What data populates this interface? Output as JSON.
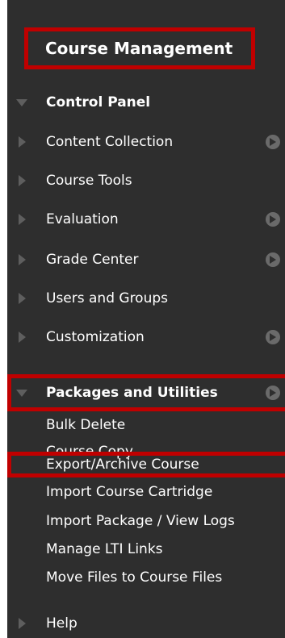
{
  "course_management": {
    "title": "Course Management",
    "accent": "#c00000"
  },
  "control_panel": {
    "label": "Control Panel",
    "expanded": true,
    "items": [
      {
        "label": "Content Collection",
        "has_arrow": true
      },
      {
        "label": "Course Tools",
        "has_arrow": false
      },
      {
        "label": "Evaluation",
        "has_arrow": true
      },
      {
        "label": "Grade Center",
        "has_arrow": true
      },
      {
        "label": "Users and Groups",
        "has_arrow": false
      },
      {
        "label": "Customization",
        "has_arrow": true
      }
    ]
  },
  "packages": {
    "label": "Packages and Utilities",
    "expanded": true,
    "items": [
      "Bulk Delete",
      "Course Copy",
      "Export/Archive Course",
      "Import Course Cartridge",
      "Import Package / View Logs",
      "Manage LTI Links",
      "Move Files to Course Files"
    ]
  },
  "help": {
    "label": "Help"
  },
  "icons": {
    "expand": "triangle-right-icon",
    "collapse": "triangle-down-icon",
    "go": "arrow-circle-icon"
  }
}
